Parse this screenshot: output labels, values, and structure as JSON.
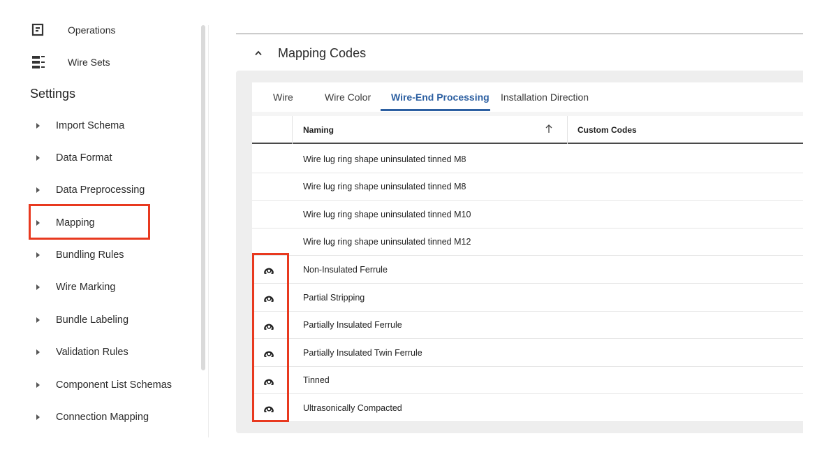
{
  "sidebar": {
    "top_items": [
      {
        "label": "Operations",
        "icon": "operations-icon"
      },
      {
        "label": "Wire Sets",
        "icon": "wire-sets-icon"
      }
    ],
    "settings_title": "Settings",
    "items": [
      {
        "label": "Import Schema"
      },
      {
        "label": "Data Format"
      },
      {
        "label": "Data Preprocessing"
      },
      {
        "label": "Mapping",
        "highlighted": true
      },
      {
        "label": "Bundling Rules"
      },
      {
        "label": "Wire Marking"
      },
      {
        "label": "Bundle Labeling"
      },
      {
        "label": "Validation Rules"
      },
      {
        "label": "Component List Schemas"
      },
      {
        "label": "Connection Mapping"
      }
    ]
  },
  "section": {
    "title": "Mapping Codes",
    "expanded": true
  },
  "tabs": [
    {
      "label": "Wire",
      "active": false
    },
    {
      "label": "Wire Color",
      "active": false
    },
    {
      "label": "Wire-End Processing",
      "active": true
    },
    {
      "label": "Installation Direction",
      "active": false
    }
  ],
  "table": {
    "columns": [
      "Naming",
      "Custom Codes"
    ],
    "sort": {
      "column": "Naming",
      "direction": "ascending"
    },
    "rows": [
      {
        "naming": "Wire lug ring shape uninsulated tinned M8",
        "custom_codes": "",
        "has_icon": false
      },
      {
        "naming": "Wire lug ring shape uninsulated tinned M8",
        "custom_codes": "",
        "has_icon": false
      },
      {
        "naming": "Wire lug ring shape uninsulated tinned M10",
        "custom_codes": "",
        "has_icon": false
      },
      {
        "naming": "Wire lug ring shape uninsulated tinned M12",
        "custom_codes": "",
        "has_icon": false
      },
      {
        "naming": "Non-Insulated Ferrule",
        "custom_codes": "",
        "has_icon": true
      },
      {
        "naming": "Partial Stripping",
        "custom_codes": "",
        "has_icon": true
      },
      {
        "naming": "Partially Insulated Ferrule",
        "custom_codes": "",
        "has_icon": true
      },
      {
        "naming": "Partially Insulated Twin Ferrule",
        "custom_codes": "",
        "has_icon": true
      },
      {
        "naming": "Tinned",
        "custom_codes": "",
        "has_icon": true
      },
      {
        "naming": "Ultrasonically Compacted",
        "custom_codes": "",
        "has_icon": true
      }
    ],
    "row_icon": "user-helmet-icon"
  },
  "colors": {
    "accent": "#2c5fa1",
    "highlight": "#e8391f",
    "panel_bg": "#eeeeee"
  }
}
